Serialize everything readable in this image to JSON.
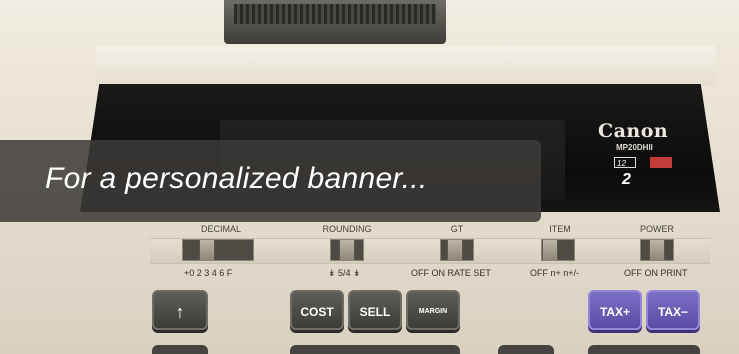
{
  "banner": {
    "text": "For a personalized banner..."
  },
  "device": {
    "brand": "Canon",
    "model": "MP20DHII",
    "badge_12": "12",
    "badge_2": "2"
  },
  "switches": [
    {
      "label": "DECIMAL",
      "scale": "+0 2 3 4 6 F"
    },
    {
      "label": "ROUNDING",
      "scale": "↡ 5/4 ↡"
    },
    {
      "label": "GT",
      "scale": "OFF ON RATE SET"
    },
    {
      "label": "ITEM",
      "scale": "OFF n+ n+/-"
    },
    {
      "label": "POWER",
      "scale": "OFF ON PRINT"
    }
  ],
  "keys": {
    "up_arrow": "↑",
    "cost": "COST",
    "sell": "SELL",
    "margin": "MARGIN",
    "tax_plus": "TAX+",
    "tax_minus": "TAX−"
  },
  "colors": {
    "banner_bg": "#3c3a38",
    "key_purple": "#6a5cbf",
    "display_black": "#121110"
  }
}
